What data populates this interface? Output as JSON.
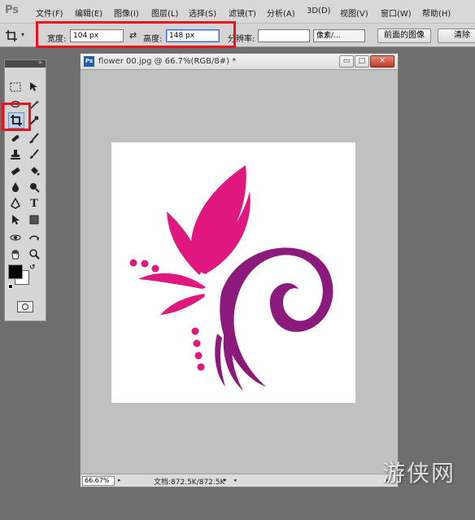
{
  "app": {
    "logo": "Ps"
  },
  "menu": {
    "items": [
      "文件(F)",
      "编辑(E)",
      "图像(I)",
      "图层(L)",
      "选择(S)",
      "滤镜(T)",
      "分析(A)",
      "3D(D)",
      "视图(V)",
      "窗口(W)",
      "帮助(H)"
    ]
  },
  "options": {
    "width_label": "宽度:",
    "width_value": "104 px",
    "swap_icon": "swap-arrows-icon",
    "height_label": "高度:",
    "height_value": "148 px",
    "resolution_label": "分辨率:",
    "resolution_value": "",
    "unit_select": "像素/...",
    "front_image_button": "前面的图像",
    "clear_button": "清除"
  },
  "document": {
    "title": "flower 00.jpg @ 66.7%(RGB/8#) *",
    "minimize": "▭",
    "restore": "□",
    "close": "✕",
    "zoom": "66.67%",
    "status": "文档:872.5K/872.5K"
  },
  "colors": {
    "pink": "#e0177f",
    "purple": "#8b1a7c",
    "highlight": "#e8141c"
  },
  "watermark": "游侠网"
}
